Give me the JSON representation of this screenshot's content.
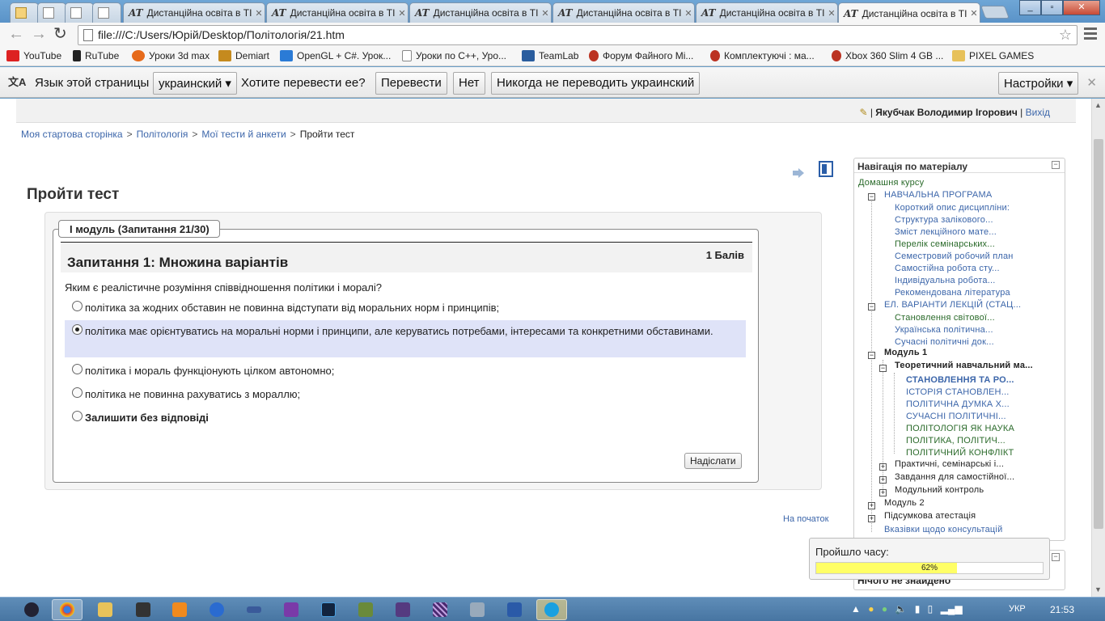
{
  "tabs": [
    {
      "label": ""
    },
    {
      "label": ""
    },
    {
      "label": ""
    },
    {
      "label": "Дистанційна освіта в ТІ"
    },
    {
      "label": "Дистанційна освіта в ТІ"
    },
    {
      "label": "Дистанційна освіта в ТІ"
    },
    {
      "label": "Дистанційна освіта в ТІ"
    },
    {
      "label": "Дистанційна освіта в ТІ"
    },
    {
      "label": "Дистанційна освіта в ТІ"
    }
  ],
  "tab_favicon_text": "AT",
  "address": "file:///C:/Users/Юрій/Desktop/Політологія/21.htm",
  "bookmarks": [
    "YouTube",
    "RuTube",
    "Уроки 3d max",
    "Demiart",
    "OpenGL + C#. Урок...",
    "Уроки по С++, Уро...",
    "TeamLab",
    "Форум Файного Мі...",
    "Комплектуючі : ма...",
    "Xbox 360 Slim 4 GB ...",
    "PIXEL GAMES"
  ],
  "translate": {
    "prompt": "Язык этой страницы",
    "language": "украинский ▾",
    "question": "Хотите перевести ее?",
    "translate_btn": "Перевести",
    "no_btn": "Нет",
    "never_btn": "Никогда не переводить украинский",
    "settings_btn": "Настройки ▾"
  },
  "user": {
    "name": "Якубчак Володимир Ігорович",
    "logout": "Вихід"
  },
  "breadcrumb": [
    "Моя стартова сторінка",
    "Політологія",
    "Мої тести й анкети",
    "Пройти тест"
  ],
  "page_title": "Пройти тест",
  "quiz": {
    "legend": "I модуль (Запитання 21/30)",
    "question_title": "Запитання 1:   Множина варіантів",
    "grade": "1 Балів",
    "question_text": "Яким є реалістичне розуміння співвідношення політики і моралі?",
    "answers": [
      "політика за жодних обставин не повинна відступати від моральних норм і принципів;",
      "політика має орієнтуватись на моральні норми і принципи, але керуватись потребами, інтересами та конкретними обставинами.",
      "політика і мораль функціонують цілком автономно;",
      "політика не повинна рахуватись з мораллю;",
      "Залишити без відповіді"
    ],
    "selected_index": 1,
    "submit": "Надіслати",
    "to_top": "На початок"
  },
  "nav": {
    "title": "Навігація по матеріалу",
    "items": [
      "Домашня курсу",
      "НАВЧАЛЬНА ПРОГРАМА",
      "Короткий опис дисципліни:",
      "Структура залікового...",
      "Зміст лекційного мате...",
      "Перелік семінарських...",
      "Семестровий робочий план",
      "Самостійна робота сту...",
      "Індивідуальна робота...",
      "Рекомендована література",
      "ЕЛ. ВАРІАНТИ ЛЕКЦІЙ (СТАЦ...",
      "Становлення світової...",
      "Українська політична...",
      "Сучасні політичні док...",
      "Модуль 1",
      "Теоретичний навчальний ма...",
      "СТАНОВЛЕННЯ ТА РО...",
      "ІСТОРІЯ СТАНОВЛЕН...",
      "ПОЛІТИЧНА ДУМКА Х...",
      "СУЧАСНІ ПОЛІТИЧНІ...",
      "ПОЛІТОЛОГІЯ ЯК НАУКА",
      "ПОЛІТИКА, ПОЛІТИЧ...",
      "ПОЛІТИЧНИЙ КОНФЛІКТ",
      "Практичні, семінарські і...",
      "Завдання для самостійної...",
      "Модульний контроль",
      "Модуль 2",
      "Підсумкова атестація",
      "Вказівки щодо консультацій"
    ]
  },
  "block2_text": "Нічого не знайдено",
  "timer": {
    "label": "Пройшло часу:",
    "percent_text": "62%",
    "progress": 0.62
  },
  "tray": {
    "lang": "УКР",
    "time": "21:53"
  }
}
